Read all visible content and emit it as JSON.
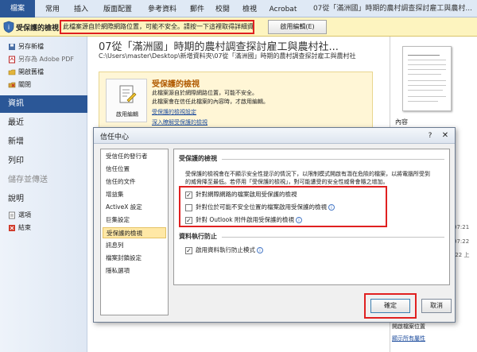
{
  "ribbon": {
    "tabs": [
      "檔案",
      "常用",
      "插入",
      "版面配置",
      "參考資料",
      "郵件",
      "校閱",
      "檢視",
      "Acrobat"
    ],
    "title_fragment": "07從「滿洲國」時期的農村調查探討雇工與農村..."
  },
  "message_bar": {
    "label": "受保護的檢視",
    "text": "此檔案源自於網際網路位置，可能不安全。請按一下這裡取得詳細資料",
    "button": "啟用編輯(E)"
  },
  "nav": {
    "save_as": "另存新檔",
    "save_pdf": "另存為 Adobe PDF",
    "open": "開啟舊檔",
    "close": "關閉",
    "info": "資訊",
    "recent": "最近",
    "new": "新增",
    "print": "列印",
    "save_send": "儲存並傳送",
    "help": "說明",
    "options": "選項",
    "exit": "結束"
  },
  "info": {
    "doc_title": "07從「滿洲國」時期的農村調查探討雇工與農村社...",
    "path": "C:\\Users\\master\\Desktop\\新增資料夾\\07從「滿洲國」時期的農村調查探討雇工與農村社",
    "panel_heading": "受保護的檢視",
    "panel_desc1": "此檔案源自於網際網路位置，可能不安全。",
    "panel_desc2": "此檔案會在信任此檔案的內容時，才啟用編輯。",
    "enable_tile": "啟用編輯",
    "link1": "受保護的檢視設定",
    "link2": "深入瞭解受保護的檢視"
  },
  "right_pane": {
    "properties_label": "內容",
    "side_values": [
      "07:21",
      "07:22",
      "/22 上"
    ],
    "open_location": "開啟檔案位置",
    "show_all": "顯示所有屬性"
  },
  "dialog": {
    "title": "信任中心",
    "help": "?",
    "close": "✕",
    "nav_items": [
      "受信任的發行者",
      "信任位置",
      "信任的文件",
      "增益集",
      "ActiveX 設定",
      "巨集設定",
      "受保護的檢視",
      "訊息列",
      "檔案封鎖設定",
      "隱私選項"
    ],
    "selected_index": 6,
    "section1_title": "受保護的檢視",
    "intro1": "受保護的檢視會在不顯示安全性提示的情況下，以限制模式開啟有潛在危險的檔案，以將電腦所受到",
    "intro2": "的威脅降至最低。若停用「受保護的檢視」，對可能遭受的安全性威脅會隨之增加。",
    "checkbox1": "針對網際網路的檔案啟用受保護的檢視",
    "checkbox2": "針對位於可能不安全位置的檔案啟用受保護的檢視",
    "checkbox3": "針對 Outlook 附件啟用受保護的檢視",
    "section2_title": "資料執行防止",
    "checkbox4": "啟用資料執行防止模式",
    "ok": "確定",
    "cancel": "取消"
  }
}
